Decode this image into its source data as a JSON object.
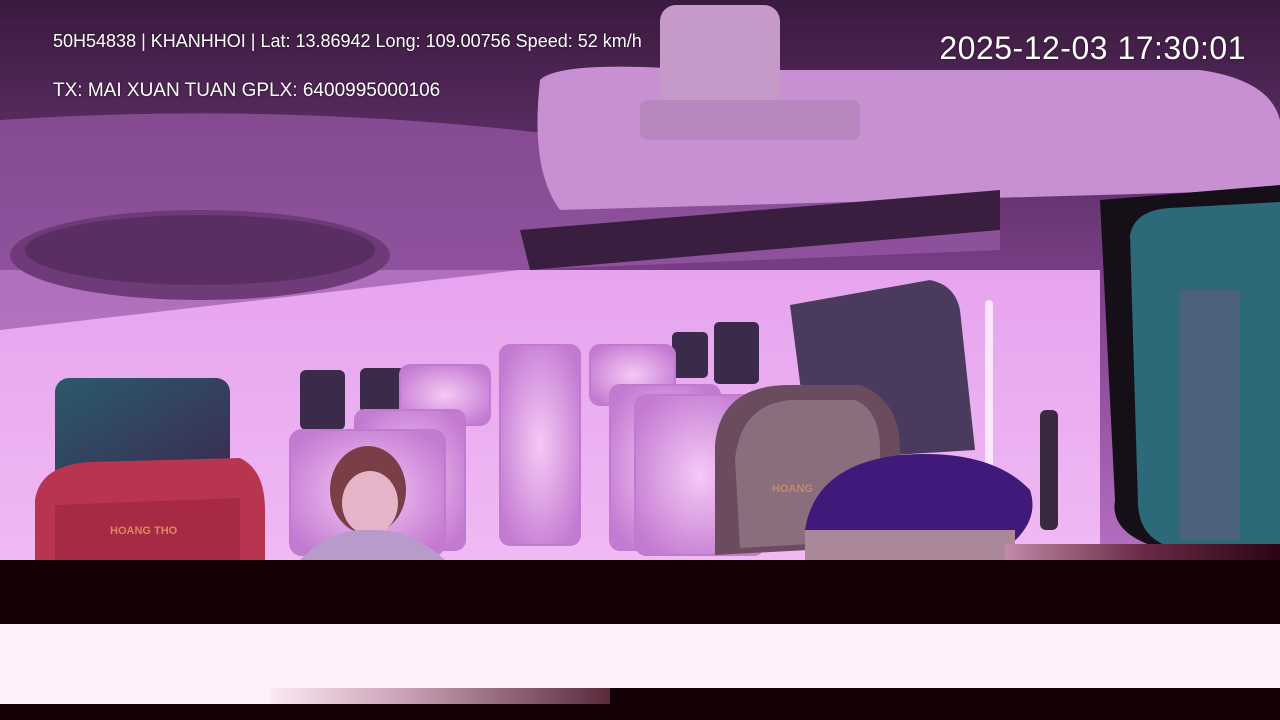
{
  "overlay": {
    "vehicle_info": "50H54838 | KHANHHOI | Lat: 13.86942 Long: 109.00756 Speed: 52 km/h",
    "driver_info": "TX: MAI XUAN TUAN GPLX: 6400995000106",
    "timestamp": "2025-12-03 17:30:01"
  },
  "seat_branding": {
    "headrest_left": "HOANG THO",
    "headrest_right": "HOANG"
  }
}
